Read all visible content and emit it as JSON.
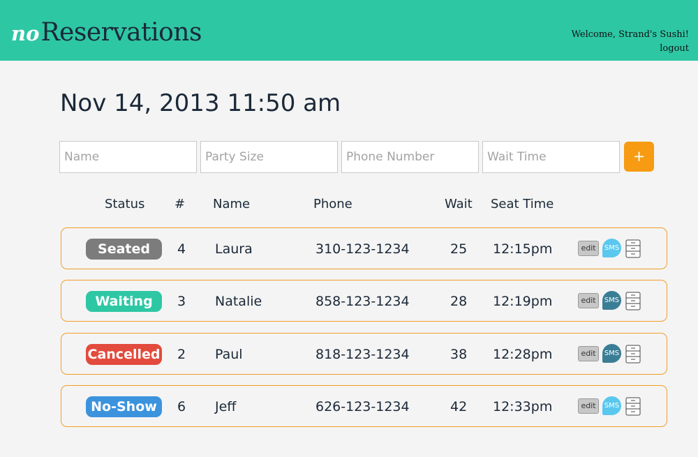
{
  "header": {
    "logo_prefix": "no",
    "logo_main": "Reservations",
    "welcome": "Welcome, Strand's Sushi!",
    "logout": "logout",
    "bg_color": "#2ec7a4"
  },
  "datetime": "Nov 14, 2013 11:50 am",
  "form": {
    "name_placeholder": "Name",
    "party_placeholder": "Party Size",
    "phone_placeholder": "Phone Number",
    "wait_placeholder": "Wait Time",
    "add_label": "+"
  },
  "columns": {
    "status": "Status",
    "num": "#",
    "name": "Name",
    "phone": "Phone",
    "wait": "Wait",
    "seat_time": "Seat Time"
  },
  "rows": [
    {
      "status": "Seated",
      "status_color": "#7c7c7c",
      "num": "4",
      "name": "Laura",
      "phone": "310-123-1234",
      "wait": "25",
      "seat_time": "12:15pm",
      "edit": "edit",
      "sms": "SMS",
      "sms_color": "#5ac8ee"
    },
    {
      "status": "Waiting",
      "status_color": "#2ec7a4",
      "num": "3",
      "name": "Natalie",
      "phone": "858-123-1234",
      "wait": "28",
      "seat_time": "12:19pm",
      "edit": "edit",
      "sms": "SMS",
      "sms_color": "#3a7e96"
    },
    {
      "status": "Cancelled",
      "status_color": "#e24b3d",
      "num": "2",
      "name": "Paul",
      "phone": "818-123-1234",
      "wait": "38",
      "seat_time": "12:28pm",
      "edit": "edit",
      "sms": "SMS",
      "sms_color": "#3a7e96"
    },
    {
      "status": "No-Show",
      "status_color": "#3b93dd",
      "num": "6",
      "name": "Jeff",
      "phone": "626-123-1234",
      "wait": "42",
      "seat_time": "12:33pm",
      "edit": "edit",
      "sms": "SMS",
      "sms_color": "#5ac8ee"
    }
  ],
  "accent": "#f39c2a"
}
